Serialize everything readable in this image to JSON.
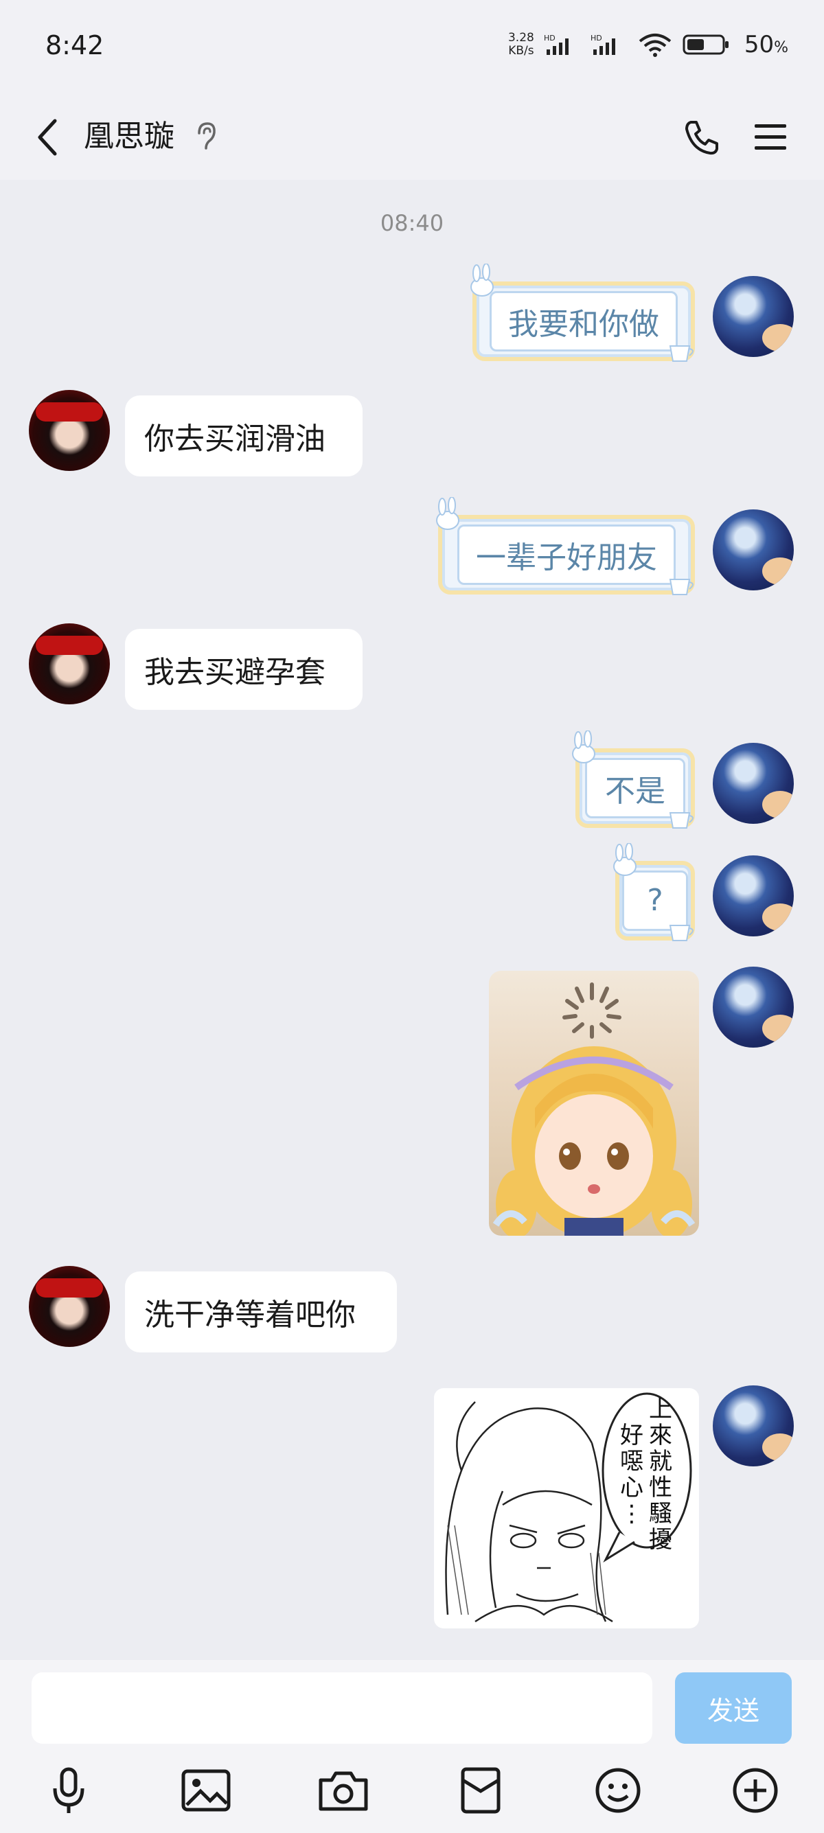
{
  "status_bar": {
    "time": "8:42",
    "net_speed_value": "3.28",
    "net_speed_unit": "KB/s",
    "battery_number": "50",
    "battery_pct": "%"
  },
  "header": {
    "contact_name": "凰思璇"
  },
  "chat": {
    "timestamp": "08:40",
    "messages": [
      {
        "from": "self",
        "text": "我要和你做"
      },
      {
        "from": "peer",
        "text": "你去买润滑油"
      },
      {
        "from": "self",
        "text": "一辈子好朋友"
      },
      {
        "from": "peer",
        "text": "我去买避孕套"
      },
      {
        "from": "self",
        "text": "不是"
      },
      {
        "from": "self",
        "text": "?"
      },
      {
        "from": "self",
        "type": "sticker"
      },
      {
        "from": "peer",
        "text": "洗干净等着吧你"
      },
      {
        "from": "self",
        "type": "sticker",
        "text": "上來就性騷擾好噁心…"
      }
    ]
  },
  "input": {
    "value": "",
    "send_label": "发送"
  },
  "toolbar": {
    "icons": [
      "microphone-icon",
      "image-icon",
      "camera-icon",
      "red-packet-icon",
      "emoji-icon",
      "plus-icon"
    ]
  },
  "colors": {
    "background": "#ecedf2",
    "send_button": "#8fc8f6",
    "outgoing_text": "#5b86a8"
  }
}
